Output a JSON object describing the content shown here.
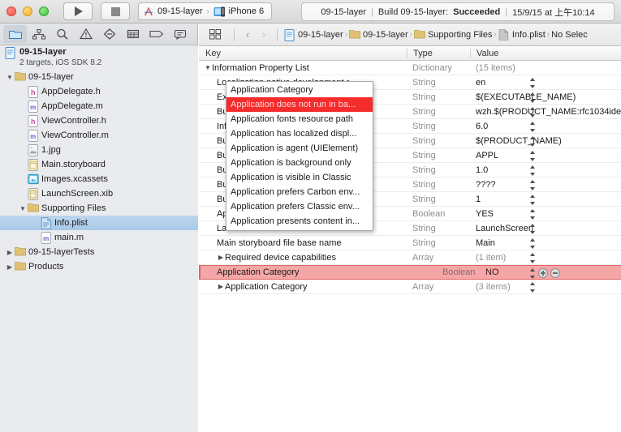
{
  "titlebar": {
    "window_controls": [
      "close",
      "minimize",
      "zoom"
    ],
    "run_label": "run",
    "stop_label": "stop",
    "scheme": {
      "project": "09-15-layer",
      "separator": "›",
      "destination": "iPhone 6"
    },
    "status": {
      "project": "09-15-layer",
      "sep": "|",
      "build_prefix": "Build 09-15-layer:",
      "build_result": "Succeeded",
      "sep2": "|",
      "timestamp": "15/9/15 at 上午10:14"
    }
  },
  "navigator": {
    "toolbar_icons": [
      {
        "name": "folder-icon",
        "active": true
      },
      {
        "name": "source-control-icon",
        "active": false
      },
      {
        "name": "search-icon",
        "active": false
      },
      {
        "name": "issue-warning-icon",
        "active": false
      },
      {
        "name": "test-icon",
        "active": false
      },
      {
        "name": "debug-icon",
        "active": false
      },
      {
        "name": "breakpoint-icon",
        "active": false
      },
      {
        "name": "report-icon",
        "active": false
      }
    ],
    "project": {
      "name": "09-15-layer",
      "subtitle": "2 targets, iOS SDK 8.2"
    },
    "items": [
      {
        "label": "09-15-layer",
        "icon": "folder-icon",
        "indent": 0,
        "disclosure": "open",
        "selected": false
      },
      {
        "label": "AppDelegate.h",
        "icon": "header-file-icon",
        "indent": 1,
        "disclosure": "",
        "selected": false
      },
      {
        "label": "AppDelegate.m",
        "icon": "source-file-icon",
        "indent": 1,
        "disclosure": "",
        "selected": false
      },
      {
        "label": "ViewController.h",
        "icon": "header-file-icon",
        "indent": 1,
        "disclosure": "",
        "selected": false
      },
      {
        "label": "ViewController.m",
        "icon": "source-file-icon",
        "indent": 1,
        "disclosure": "",
        "selected": false
      },
      {
        "label": "1.jpg",
        "icon": "image-file-icon",
        "indent": 1,
        "disclosure": "",
        "selected": false
      },
      {
        "label": "Main.storyboard",
        "icon": "storyboard-file-icon",
        "indent": 1,
        "disclosure": "",
        "selected": false
      },
      {
        "label": "Images.xcassets",
        "icon": "assets-catalog-icon",
        "indent": 1,
        "disclosure": "",
        "selected": false
      },
      {
        "label": "LaunchScreen.xib",
        "icon": "xib-file-icon",
        "indent": 1,
        "disclosure": "",
        "selected": false
      },
      {
        "label": "Supporting Files",
        "icon": "folder-icon",
        "indent": 1,
        "disclosure": "open",
        "selected": false
      },
      {
        "label": "Info.plist",
        "icon": "plist-file-icon",
        "indent": 2,
        "disclosure": "",
        "selected": true
      },
      {
        "label": "main.m",
        "icon": "source-file-icon",
        "indent": 2,
        "disclosure": "",
        "selected": false
      },
      {
        "label": "09-15-layerTests",
        "icon": "folder-icon",
        "indent": 0,
        "disclosure": "closed",
        "selected": false
      },
      {
        "label": "Products",
        "icon": "folder-icon",
        "indent": 0,
        "disclosure": "closed",
        "selected": false
      }
    ]
  },
  "editor": {
    "jumpbar": {
      "grid_icon": "editor-layout-icon",
      "back": "‹",
      "forward": "›",
      "crumbs": [
        {
          "label": "09-15-layer",
          "icon": "project-icon"
        },
        {
          "label": "09-15-layer",
          "icon": "folder-icon"
        },
        {
          "label": "Supporting Files",
          "icon": "folder-icon"
        },
        {
          "label": "Info.plist",
          "icon": "plist-file-icon"
        },
        {
          "label": "No Selec",
          "icon": ""
        }
      ]
    },
    "columns": [
      "Key",
      "Type",
      "Value"
    ],
    "rows": [
      {
        "key": "Information Property List",
        "type": "Dictionary",
        "value": "(15 items)",
        "indent": 0,
        "disclosure": "open",
        "dim": true,
        "stepper": false
      },
      {
        "key": "Localization native development r...",
        "type": "String",
        "value": "en",
        "indent": 1,
        "disclosure": "",
        "dim": false,
        "stepper": true
      },
      {
        "key": "Executable file",
        "type": "String",
        "value": "$(EXECUTABLE_NAME)",
        "indent": 1,
        "disclosure": "",
        "dim": false,
        "stepper": true
      },
      {
        "key": "Bundle identifier",
        "type": "String",
        "value": "wzh.$(PRODUCT_NAME:rfc1034ide",
        "indent": 1,
        "disclosure": "",
        "dim": false,
        "stepper": true
      },
      {
        "key": "InfoDictionary version",
        "type": "String",
        "value": "6.0",
        "indent": 1,
        "disclosure": "",
        "dim": false,
        "stepper": true
      },
      {
        "key": "Bundle name",
        "type": "String",
        "value": "$(PRODUCT_NAME)",
        "indent": 1,
        "disclosure": "",
        "dim": false,
        "stepper": true
      },
      {
        "key": "Bundle OS Type code",
        "type": "String",
        "value": "APPL",
        "indent": 1,
        "disclosure": "",
        "dim": false,
        "stepper": true
      },
      {
        "key": "Bundle versions string, short",
        "type": "String",
        "value": "1.0",
        "indent": 1,
        "disclosure": "",
        "dim": false,
        "stepper": true
      },
      {
        "key": "Bundle creator OS Type code",
        "type": "String",
        "value": "????",
        "indent": 1,
        "disclosure": "",
        "dim": false,
        "stepper": true
      },
      {
        "key": "Bundle version",
        "type": "String",
        "value": "1",
        "indent": 1,
        "disclosure": "",
        "dim": false,
        "stepper": true
      },
      {
        "key": "Application requires iPhone envir...",
        "type": "Boolean",
        "value": "YES",
        "indent": 1,
        "disclosure": "",
        "dim": false,
        "stepper": true
      },
      {
        "key": "Launch screen interface file base...",
        "type": "String",
        "value": "LaunchScreen",
        "indent": 1,
        "disclosure": "",
        "dim": false,
        "stepper": true
      },
      {
        "key": "Main storyboard file base name",
        "type": "String",
        "value": "Main",
        "indent": 1,
        "disclosure": "",
        "dim": false,
        "stepper": true
      },
      {
        "key": "Required device capabilities",
        "type": "Array",
        "value": "(1 item)",
        "indent": 1,
        "disclosure": "closed",
        "dim": true,
        "stepper": true
      }
    ],
    "editing_row": {
      "key": "Application Category",
      "type": "Boolean",
      "value": "NO",
      "add_button": "add-row-button",
      "remove_button": "remove-row-button"
    },
    "row_after": {
      "key": "Application Category",
      "type": "Array",
      "value": "(3 items)",
      "disclosure": "closed"
    },
    "dropdown": {
      "selected_index": 1,
      "items": [
        "Application Category",
        "Application does not run in ba...",
        "Application fonts resource path",
        "Application has localized displ...",
        "Application is agent (UIElement)",
        "Application is background only",
        "Application is visible in Classic",
        "Application prefers Carbon env...",
        "Application prefers Classic env...",
        "Application presents content in..."
      ]
    }
  },
  "colors": {
    "highlight_row": "#f5a6a6",
    "highlight_border": "#e06565",
    "dropdown_selection": "#f52c2c",
    "nav_selection": "#a8c9e7",
    "build_succeeded": "#2b2b2b"
  }
}
